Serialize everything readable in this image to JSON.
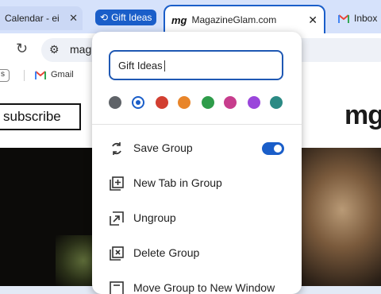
{
  "tabs": {
    "calendar": {
      "title": "Calendar - ei"
    },
    "group": {
      "label": "Gift Ideas"
    },
    "active": {
      "logo": "mg",
      "title": "MagazineGlam.com"
    },
    "inbox": {
      "title": "Inbox"
    }
  },
  "toolbar": {
    "url": "mag"
  },
  "bookmarks": {
    "chip_label": "s",
    "gmail_label": "Gmail"
  },
  "page": {
    "subscribe_label": "subscribe",
    "logo_text": "mg"
  },
  "popup": {
    "group_name": "Gift Ideas",
    "colors": [
      "#5f6368",
      "#1a5ec9",
      "#d23f31",
      "#e8852a",
      "#2e9c4a",
      "#c73d8d",
      "#9a46db",
      "#2b8a84"
    ],
    "selected_color": "#1a5ec9",
    "menu": {
      "save": "Save Group",
      "new_tab": "New Tab in Group",
      "ungroup": "Ungroup",
      "delete": "Delete Group",
      "move": "Move Group to New Window"
    },
    "save_toggle_on": true
  }
}
